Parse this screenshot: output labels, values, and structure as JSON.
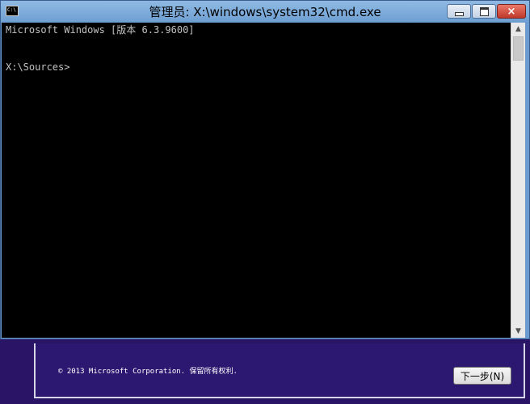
{
  "window": {
    "title": "管理员: X:\\windows\\system32\\cmd.exe",
    "icon": "C:\\",
    "controls": {
      "minimize": "minimize-icon",
      "maximize": "maximize-icon",
      "close": "×"
    }
  },
  "console": {
    "lines": [
      "Microsoft Windows [版本 6.3.9600]",
      "X:\\Sources>"
    ]
  },
  "setup": {
    "copyright": "© 2013 Microsoft Corporation. 保留所有权利.",
    "next_label": "下一步(N)"
  },
  "colors": {
    "console_bg": "#000000",
    "console_text": "#c0c0c0",
    "setup_bg": "#2a1466",
    "titlebar": "#8fb9e3",
    "close_button": "#c0392b"
  }
}
